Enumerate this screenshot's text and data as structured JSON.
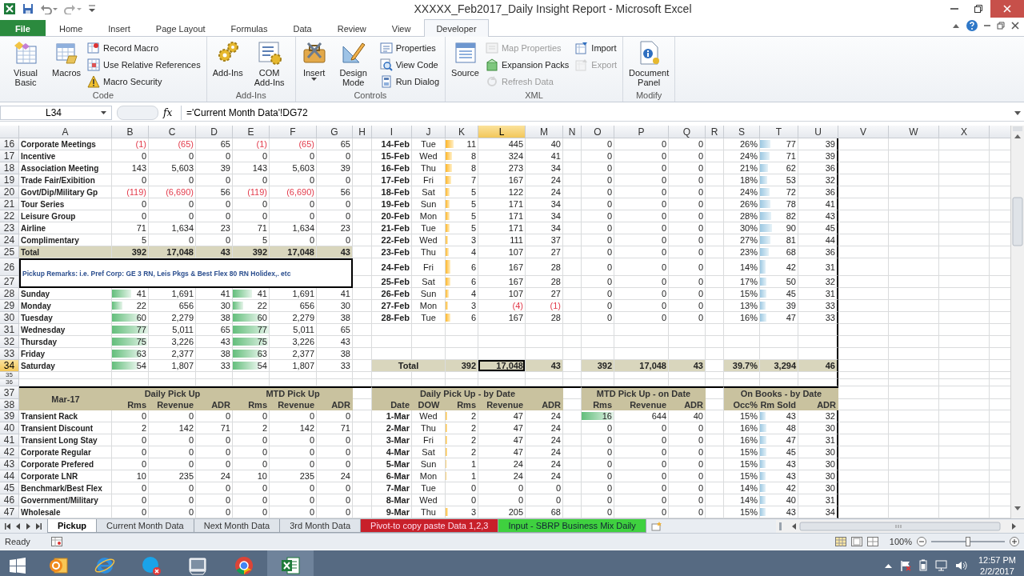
{
  "title_bar": {
    "title": "XXXXX_Feb2017_Daily Insight Report  -  Microsoft Excel"
  },
  "ribbon": {
    "tabs": [
      {
        "label": "File",
        "kind": "file",
        "selected": false
      },
      {
        "label": "Home",
        "kind": "tab",
        "selected": false
      },
      {
        "label": "Insert",
        "kind": "tab",
        "selected": false
      },
      {
        "label": "Page Layout",
        "kind": "tab",
        "selected": false
      },
      {
        "label": "Formulas",
        "kind": "tab",
        "selected": false
      },
      {
        "label": "Data",
        "kind": "tab",
        "selected": false
      },
      {
        "label": "Review",
        "kind": "tab",
        "selected": false
      },
      {
        "label": "View",
        "kind": "tab",
        "selected": false
      },
      {
        "label": "Developer",
        "kind": "tab",
        "selected": true
      }
    ],
    "groups": [
      {
        "label": "Code",
        "buttons": [
          {
            "label": "Visual Basic",
            "kind": "large",
            "disabled": false
          },
          {
            "label": "Macros",
            "kind": "large",
            "disabled": false
          },
          {
            "label": "Record Macro",
            "kind": "small",
            "disabled": false
          },
          {
            "label": "Use Relative References",
            "kind": "small",
            "disabled": false
          },
          {
            "label": "Macro Security",
            "kind": "small",
            "disabled": false
          }
        ]
      },
      {
        "label": "Add-Ins",
        "buttons": [
          {
            "label": "Add-Ins",
            "kind": "large",
            "disabled": false
          },
          {
            "label": "COM Add-Ins",
            "kind": "large",
            "disabled": false
          }
        ]
      },
      {
        "label": "Controls",
        "buttons": [
          {
            "label": "Insert",
            "kind": "large",
            "disabled": false,
            "dropdown": true
          },
          {
            "label": "Design Mode",
            "kind": "large",
            "disabled": false
          },
          {
            "label": "Properties",
            "kind": "small",
            "disabled": false
          },
          {
            "label": "View Code",
            "kind": "small",
            "disabled": false
          },
          {
            "label": "Run Dialog",
            "kind": "small",
            "disabled": false
          }
        ]
      },
      {
        "label": "XML",
        "buttons": [
          {
            "label": "Source",
            "kind": "large",
            "disabled": false
          },
          {
            "label": "Map Properties",
            "kind": "small",
            "disabled": true
          },
          {
            "label": "Expansion Packs",
            "kind": "small",
            "disabled": false
          },
          {
            "label": "Refresh Data",
            "kind": "small",
            "disabled": true
          },
          {
            "label": "Import",
            "kind": "small",
            "disabled": false
          },
          {
            "label": "Export",
            "kind": "small",
            "disabled": true
          }
        ]
      },
      {
        "label": "Modify",
        "buttons": [
          {
            "label": "Document Panel",
            "kind": "large",
            "disabled": false
          }
        ]
      }
    ]
  },
  "formula_bar": {
    "name_box": "L34",
    "function_label": "fx",
    "formula": "='Current Month Data'!DG72"
  },
  "sheet": {
    "columns": [
      {
        "label": "A",
        "selected": false
      },
      {
        "label": "B",
        "selected": false
      },
      {
        "label": "C",
        "selected": false
      },
      {
        "label": "D",
        "selected": false
      },
      {
        "label": "E",
        "selected": false
      },
      {
        "label": "F",
        "selected": false
      },
      {
        "label": "G",
        "selected": false
      },
      {
        "label": "H",
        "selected": false
      },
      {
        "label": "I",
        "selected": false
      },
      {
        "label": "J",
        "selected": false
      },
      {
        "label": "K",
        "selected": false
      },
      {
        "label": "L",
        "selected": true
      },
      {
        "label": "M",
        "selected": false
      },
      {
        "label": "N",
        "selected": false
      },
      {
        "label": "O",
        "selected": false
      },
      {
        "label": "P",
        "selected": false
      },
      {
        "label": "Q",
        "selected": false
      },
      {
        "label": "R",
        "selected": false
      },
      {
        "label": "S",
        "selected": false
      },
      {
        "label": "T",
        "selected": false
      },
      {
        "label": "U",
        "selected": false
      },
      {
        "label": "V",
        "selected": false
      },
      {
        "label": "W",
        "selected": false
      },
      {
        "label": "X",
        "selected": false
      }
    ],
    "rows": [
      {
        "number": "16",
        "kind": "data",
        "selected": false,
        "cells": {
          "A": "Corporate Meetings",
          "B": {
            "text": "(1)",
            "negative": true
          },
          "C": {
            "text": "(65)",
            "negative": true
          },
          "D": "65",
          "E": {
            "text": "(1)",
            "negative": true
          },
          "F": {
            "text": "(65)",
            "negative": true
          },
          "G": "65",
          "I": "14-Feb",
          "J": "Tue",
          "K": {
            "text": "11",
            "level": 0.26
          },
          "L": "445",
          "M": "40",
          "O": "0",
          "P": "0",
          "Q": "0",
          "S": "26%",
          "T": {
            "text": "77",
            "level": 0.27
          },
          "U": "39"
        }
      },
      {
        "number": "17",
        "kind": "data",
        "selected": false,
        "cells": {
          "A": "Incentive",
          "B": "0",
          "C": "0",
          "D": "0",
          "E": "0",
          "F": "0",
          "G": "0",
          "I": "15-Feb",
          "J": "Wed",
          "K": {
            "text": "8",
            "level": 0.19
          },
          "L": "324",
          "M": "41",
          "O": "0",
          "P": "0",
          "Q": "0",
          "S": "24%",
          "T": {
            "text": "71",
            "level": 0.25
          },
          "U": "39"
        }
      },
      {
        "number": "18",
        "kind": "data",
        "selected": false,
        "cells": {
          "A": "Association Meeting",
          "B": "143",
          "C": "5,603",
          "D": "39",
          "E": "143",
          "F": "5,603",
          "G": "39",
          "I": "16-Feb",
          "J": "Thu",
          "K": {
            "text": "8",
            "level": 0.19
          },
          "L": "273",
          "M": "34",
          "O": "0",
          "P": "0",
          "Q": "0",
          "S": "21%",
          "T": {
            "text": "62",
            "level": 0.22
          },
          "U": "36"
        }
      },
      {
        "number": "19",
        "kind": "data",
        "selected": false,
        "cells": {
          "A": "Trade Fair/Exibition",
          "B": "0",
          "C": "0",
          "D": "0",
          "E": "0",
          "F": "0",
          "G": "0",
          "I": "17-Feb",
          "J": "Fri",
          "K": {
            "text": "7",
            "level": 0.17
          },
          "L": "167",
          "M": "24",
          "O": "0",
          "P": "0",
          "Q": "0",
          "S": "18%",
          "T": {
            "text": "53",
            "level": 0.19
          },
          "U": "32"
        }
      },
      {
        "number": "20",
        "kind": "data",
        "selected": false,
        "cells": {
          "A": "Govt/Dip/Military Gp",
          "B": {
            "text": "(119)",
            "negative": true
          },
          "C": {
            "text": "(6,690)",
            "negative": true
          },
          "D": "56",
          "E": {
            "text": "(119)",
            "negative": true
          },
          "F": {
            "text": "(6,690)",
            "negative": true
          },
          "G": "56",
          "I": "18-Feb",
          "J": "Sat",
          "K": {
            "text": "5",
            "level": 0.12
          },
          "L": "122",
          "M": "24",
          "O": "0",
          "P": "0",
          "Q": "0",
          "S": "24%",
          "T": {
            "text": "72",
            "level": 0.25
          },
          "U": "36"
        }
      },
      {
        "number": "21",
        "kind": "data",
        "selected": false,
        "cells": {
          "A": "Tour Series",
          "B": "0",
          "C": "0",
          "D": "0",
          "E": "0",
          "F": "0",
          "G": "0",
          "I": "19-Feb",
          "J": "Sun",
          "K": {
            "text": "5",
            "level": 0.12
          },
          "L": "171",
          "M": "34",
          "O": "0",
          "P": "0",
          "Q": "0",
          "S": "26%",
          "T": {
            "text": "78",
            "level": 0.27
          },
          "U": "41"
        }
      },
      {
        "number": "22",
        "kind": "data",
        "selected": false,
        "cells": {
          "A": "Leisure Group",
          "B": "0",
          "C": "0",
          "D": "0",
          "E": "0",
          "F": "0",
          "G": "0",
          "I": "20-Feb",
          "J": "Mon",
          "K": {
            "text": "5",
            "level": 0.12
          },
          "L": "171",
          "M": "34",
          "O": "0",
          "P": "0",
          "Q": "0",
          "S": "28%",
          "T": {
            "text": "82",
            "level": 0.29
          },
          "U": "43"
        }
      },
      {
        "number": "23",
        "kind": "data",
        "selected": false,
        "cells": {
          "A": "Airline",
          "B": "71",
          "C": "1,634",
          "D": "23",
          "E": "71",
          "F": "1,634",
          "G": "23",
          "I": "21-Feb",
          "J": "Tue",
          "K": {
            "text": "5",
            "level": 0.12
          },
          "L": "171",
          "M": "34",
          "O": "0",
          "P": "0",
          "Q": "0",
          "S": "30%",
          "T": {
            "text": "90",
            "level": 0.32
          },
          "U": "45"
        }
      },
      {
        "number": "24",
        "kind": "data",
        "selected": false,
        "cells": {
          "A": "Complimentary",
          "B": "5",
          "C": "0",
          "D": "0",
          "E": "5",
          "F": "0",
          "G": "0",
          "I": "22-Feb",
          "J": "Wed",
          "K": {
            "text": "3",
            "level": 0.07
          },
          "L": "111",
          "M": "37",
          "O": "0",
          "P": "0",
          "Q": "0",
          "S": "27%",
          "T": {
            "text": "81",
            "level": 0.28
          },
          "U": "44"
        }
      },
      {
        "number": "25",
        "kind": "data",
        "selected": false,
        "cells": {
          "A": {
            "text": "Total",
            "shaded": true
          },
          "B": {
            "text": "392",
            "shaded": true
          },
          "C": {
            "text": "17,048",
            "shaded": true
          },
          "D": {
            "text": "43",
            "shaded": true
          },
          "E": {
            "text": "392",
            "shaded": true
          },
          "F": {
            "text": "17,048",
            "shaded": true
          },
          "G": {
            "text": "43",
            "shaded": true
          },
          "I": "23-Feb",
          "J": "Thu",
          "K": {
            "text": "4",
            "level": 0.1
          },
          "L": "107",
          "M": "27",
          "O": "0",
          "P": "0",
          "Q": "0",
          "S": "23%",
          "T": {
            "text": "68",
            "level": 0.24
          },
          "U": "36"
        }
      },
      {
        "number": "26",
        "kind": "remark",
        "selected": false,
        "remark": "Pickup Remarks: i.e. Pref Corp: GE 3 RN, Leis Pkgs & Best Flex 80 RN Holidex,. etc",
        "cells": {
          "I": "24-Feb",
          "J": "Fri",
          "K": {
            "text": "6",
            "level": 0.14
          },
          "L": "167",
          "M": "28",
          "O": "0",
          "P": "0",
          "Q": "0",
          "S": "14%",
          "T": {
            "text": "42",
            "level": 0.15
          },
          "U": "31"
        }
      },
      {
        "number": "27",
        "kind": "data",
        "selected": false,
        "cells": {
          "I": "25-Feb",
          "J": "Sat",
          "K": {
            "text": "6",
            "level": 0.14
          },
          "L": "167",
          "M": "28",
          "O": "0",
          "P": "0",
          "Q": "0",
          "S": "17%",
          "T": {
            "text": "50",
            "level": 0.17
          },
          "U": "32"
        }
      },
      {
        "number": "28",
        "kind": "data",
        "selected": false,
        "cells": {
          "A": "Sunday",
          "B": {
            "text": "41",
            "level": 0.53
          },
          "C": "1,691",
          "D": "41",
          "E": {
            "text": "41",
            "level": 0.53
          },
          "F": "1,691",
          "G": "41",
          "I": "26-Feb",
          "J": "Sun",
          "K": {
            "text": "4",
            "level": 0.1
          },
          "L": "107",
          "M": "27",
          "O": "0",
          "P": "0",
          "Q": "0",
          "S": "15%",
          "T": {
            "text": "45",
            "level": 0.16
          },
          "U": "31"
        }
      },
      {
        "number": "29",
        "kind": "data",
        "selected": false,
        "cells": {
          "A": "Monday",
          "B": {
            "text": "22",
            "level": 0.29
          },
          "C": "656",
          "D": "30",
          "E": {
            "text": "22",
            "level": 0.29
          },
          "F": "656",
          "G": "30",
          "I": "27-Feb",
          "J": "Mon",
          "K": {
            "text": "3",
            "level": 0.07
          },
          "L": {
            "text": "(4)",
            "negative": true
          },
          "M": {
            "text": "(1)",
            "negative": true
          },
          "O": "0",
          "P": "0",
          "Q": "0",
          "S": "13%",
          "T": {
            "text": "39",
            "level": 0.14
          },
          "U": "33"
        }
      },
      {
        "number": "30",
        "kind": "data",
        "selected": false,
        "cells": {
          "A": "Tuesday",
          "B": {
            "text": "60",
            "level": 0.78
          },
          "C": "2,279",
          "D": "38",
          "E": {
            "text": "60",
            "level": 0.78
          },
          "F": "2,279",
          "G": "38",
          "I": "28-Feb",
          "J": "Tue",
          "K": {
            "text": "6",
            "level": 0.14
          },
          "L": "167",
          "M": "28",
          "O": "0",
          "P": "0",
          "Q": "0",
          "S": "16%",
          "T": {
            "text": "47",
            "level": 0.16
          },
          "U": "33"
        }
      },
      {
        "number": "31",
        "kind": "data",
        "selected": false,
        "cells": {
          "A": "Wednesday",
          "B": {
            "text": "77",
            "level": 1
          },
          "C": "5,011",
          "D": "65",
          "E": {
            "text": "77",
            "level": 1
          },
          "F": "5,011",
          "G": "65"
        }
      },
      {
        "number": "32",
        "kind": "data",
        "selected": false,
        "cells": {
          "A": "Thursday",
          "B": {
            "text": "75",
            "level": 0.97
          },
          "C": "3,226",
          "D": "43",
          "E": {
            "text": "75",
            "level": 0.97
          },
          "F": "3,226",
          "G": "43"
        }
      },
      {
        "number": "33",
        "kind": "data",
        "selected": false,
        "cells": {
          "A": "Friday",
          "B": {
            "text": "63",
            "level": 0.82
          },
          "C": "2,377",
          "D": "38",
          "E": {
            "text": "63",
            "level": 0.82
          },
          "F": "2,377",
          "G": "38"
        }
      },
      {
        "number": "34",
        "kind": "data",
        "selected": true,
        "cells": {
          "A": "Saturday",
          "B": {
            "text": "54",
            "level": 0.7
          },
          "C": "1,807",
          "D": "33",
          "E": {
            "text": "54",
            "level": 0.7
          },
          "F": "1,807",
          "G": "33",
          "I": {
            "text": "Total",
            "shaded": true,
            "merged": true
          },
          "K": {
            "text": "392",
            "shaded": true
          },
          "L": {
            "text": "17,048",
            "shaded": true
          },
          "M": {
            "text": "43",
            "shaded": true
          },
          "O": {
            "text": "392",
            "shaded": true
          },
          "P": {
            "text": "17,048",
            "shaded": true
          },
          "Q": {
            "text": "43",
            "shaded": true
          },
          "S": {
            "text": "39.7%",
            "shaded": true
          },
          "T": {
            "text": "3,294",
            "shaded": true
          },
          "U": {
            "text": "46",
            "shaded": true
          }
        }
      },
      {
        "number": "35",
        "kind": "spacer",
        "selected": false
      },
      {
        "number": "36",
        "kind": "spacer",
        "selected": false
      },
      {
        "numbers": [
          "37",
          "38"
        ],
        "kind": "header",
        "selected": false,
        "groups": {
          "A": {
            "label": "Mar-17"
          },
          "B": {
            "label": "Daily Pick Up",
            "subheaders": [
              "Rms",
              "Revenue",
              "ADR"
            ]
          },
          "E": {
            "label": "MTD Pick Up",
            "subheaders": [
              "Rms",
              "Revenue",
              "ADR"
            ]
          },
          "I": {
            "label": "Daily Pick Up - by Date",
            "subheaders": [
              "Date",
              "DOW",
              "Rms",
              "Revenue",
              "ADR"
            ]
          },
          "O": {
            "label": "MTD Pick Up - on Date",
            "subheaders": [
              "Rms",
              "Revenue",
              "ADR"
            ]
          },
          "S": {
            "label": "On Books - by Date",
            "subheaders": [
              "Occ%",
              "Rm Sold",
              "ADR"
            ]
          }
        }
      },
      {
        "number": "39",
        "kind": "data",
        "selected": false,
        "cells": {
          "A": "Transient Rack",
          "B": "0",
          "C": "0",
          "D": "0",
          "E": "0",
          "F": "0",
          "G": "0",
          "I": "1-Mar",
          "J": "Wed",
          "K": {
            "text": "2",
            "level": 0.05
          },
          "L": "47",
          "M": "24",
          "O": {
            "text": "16",
            "level": 1
          },
          "P": "644",
          "Q": "40",
          "S": "15%",
          "T": {
            "text": "43",
            "level": 0.15
          },
          "U": "32"
        }
      },
      {
        "number": "40",
        "kind": "data",
        "selected": false,
        "cells": {
          "A": "Transient Discount",
          "B": "2",
          "C": "142",
          "D": "71",
          "E": "2",
          "F": "142",
          "G": "71",
          "I": "2-Mar",
          "J": "Thu",
          "K": {
            "text": "2",
            "level": 0.05
          },
          "L": "47",
          "M": "24",
          "O": "0",
          "P": "0",
          "Q": "0",
          "S": "16%",
          "T": {
            "text": "48",
            "level": 0.17
          },
          "U": "30"
        }
      },
      {
        "number": "41",
        "kind": "data",
        "selected": false,
        "cells": {
          "A": "Transient Long Stay",
          "B": "0",
          "C": "0",
          "D": "0",
          "E": "0",
          "F": "0",
          "G": "0",
          "I": "3-Mar",
          "J": "Fri",
          "K": {
            "text": "2",
            "level": 0.05
          },
          "L": "47",
          "M": "24",
          "O": "0",
          "P": "0",
          "Q": "0",
          "S": "16%",
          "T": {
            "text": "47",
            "level": 0.16
          },
          "U": "31"
        }
      },
      {
        "number": "42",
        "kind": "data",
        "selected": false,
        "cells": {
          "A": "Corporate Regular",
          "B": "0",
          "C": "0",
          "D": "0",
          "E": "0",
          "F": "0",
          "G": "0",
          "I": "4-Mar",
          "J": "Sat",
          "K": {
            "text": "2",
            "level": 0.05
          },
          "L": "47",
          "M": "24",
          "O": "0",
          "P": "0",
          "Q": "0",
          "S": "15%",
          "T": {
            "text": "45",
            "level": 0.16
          },
          "U": "30"
        }
      },
      {
        "number": "43",
        "kind": "data",
        "selected": false,
        "cells": {
          "A": "Corporate Prefered",
          "B": "0",
          "C": "0",
          "D": "0",
          "E": "0",
          "F": "0",
          "G": "0",
          "I": "5-Mar",
          "J": "Sun",
          "K": {
            "text": "1",
            "level": 0.03
          },
          "L": "24",
          "M": "24",
          "O": "0",
          "P": "0",
          "Q": "0",
          "S": "15%",
          "T": {
            "text": "43",
            "level": 0.15
          },
          "U": "30"
        }
      },
      {
        "number": "44",
        "kind": "data",
        "selected": false,
        "cells": {
          "A": "Corporate LNR",
          "B": "10",
          "C": "235",
          "D": "24",
          "E": "10",
          "F": "235",
          "G": "24",
          "I": "6-Mar",
          "J": "Mon",
          "K": {
            "text": "1",
            "level": 0.03
          },
          "L": "24",
          "M": "24",
          "O": "0",
          "P": "0",
          "Q": "0",
          "S": "15%",
          "T": {
            "text": "43",
            "level": 0.15
          },
          "U": "30"
        }
      },
      {
        "number": "45",
        "kind": "data",
        "selected": false,
        "cells": {
          "A": "Benchmark/Best Flex",
          "B": "0",
          "C": "0",
          "D": "0",
          "E": "0",
          "F": "0",
          "G": "0",
          "I": "7-Mar",
          "J": "Tue",
          "K": "0",
          "L": "0",
          "M": "0",
          "O": "0",
          "P": "0",
          "Q": "0",
          "S": "14%",
          "T": {
            "text": "42",
            "level": 0.15
          },
          "U": "30"
        }
      },
      {
        "number": "46",
        "kind": "data",
        "selected": false,
        "cells": {
          "A": "Government/Military",
          "B": "0",
          "C": "0",
          "D": "0",
          "E": "0",
          "F": "0",
          "G": "0",
          "I": "8-Mar",
          "J": "Wed",
          "K": "0",
          "L": "0",
          "M": "0",
          "O": "0",
          "P": "0",
          "Q": "0",
          "S": "14%",
          "T": {
            "text": "40",
            "level": 0.14
          },
          "U": "31"
        }
      },
      {
        "number": "47",
        "kind": "data",
        "selected": false,
        "cells": {
          "A": "Wholesale",
          "B": "0",
          "C": "0",
          "D": "0",
          "E": "0",
          "F": "0",
          "G": "0",
          "I": "9-Mar",
          "J": "Thu",
          "K": {
            "text": "3",
            "level": 0.07
          },
          "L": "205",
          "M": "68",
          "O": "0",
          "P": "0",
          "Q": "0",
          "S": "15%",
          "T": {
            "text": "43",
            "level": 0.15
          },
          "U": "34"
        }
      }
    ]
  },
  "sheet_tabs": [
    {
      "label": "Pickup",
      "selected": true
    },
    {
      "label": "Current Month Data",
      "selected": false
    },
    {
      "label": "Next Month Data",
      "selected": false
    },
    {
      "label": "3rd Month Data",
      "selected": false
    },
    {
      "label": "Pivot-to copy paste Data 1,2,3",
      "selected": false,
      "color": "#c8202a"
    },
    {
      "label": "Input - SBRP Business Mix Daily",
      "selected": false,
      "color": "#3fd13f"
    }
  ],
  "status_bar": {
    "text": "Ready",
    "zoom": "100%",
    "zoom_slider": {
      "level": 0.5
    }
  },
  "taskbar": {
    "time": "12:57 PM",
    "date": "2/2/2017"
  }
}
